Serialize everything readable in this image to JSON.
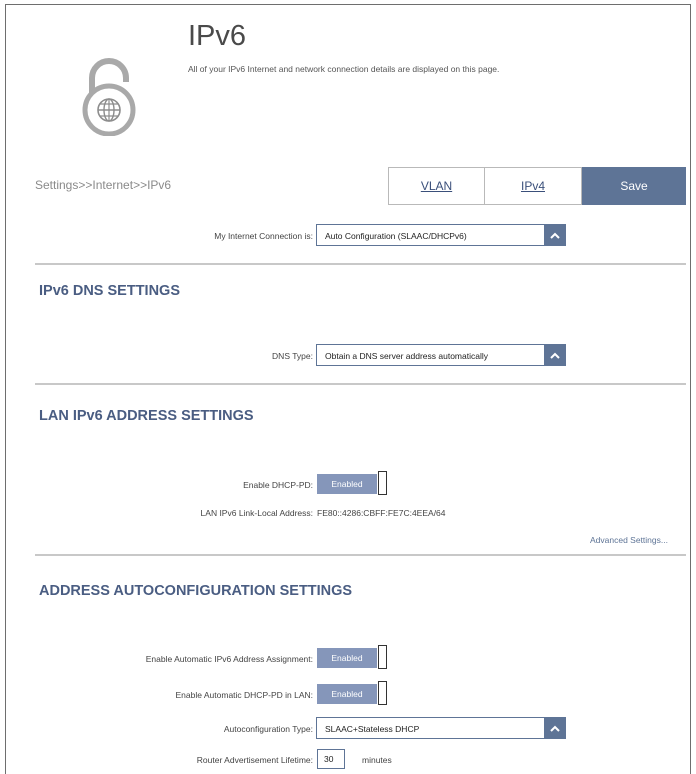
{
  "header": {
    "title": "IPv6",
    "description": "All of your IPv6 Internet and network connection details are displayed on this page."
  },
  "breadcrumb": "Settings>>Internet>>IPv6",
  "toolbar": {
    "vlan_label": "VLAN",
    "ipv4_label": "IPv4",
    "save_label": "Save"
  },
  "connection": {
    "label": "My Internet Connection is:",
    "value": "Auto Configuration (SLAAC/DHCPv6)"
  },
  "dns_section": {
    "title": "IPv6 DNS SETTINGS",
    "dns_type_label": "DNS Type:",
    "dns_type_value": "Obtain a DNS server address automatically"
  },
  "lan_section": {
    "title": "LAN IPv6 ADDRESS SETTINGS",
    "dhcp_pd_label": "Enable DHCP-PD:",
    "dhcp_pd_state": "Enabled",
    "link_local_label": "LAN IPv6 Link-Local Address:",
    "link_local_value": "FE80::4286:CBFF:FE7C:4EEA/64",
    "advanced_link": "Advanced Settings..."
  },
  "autoconf_section": {
    "title": "ADDRESS AUTOCONFIGURATION SETTINGS",
    "auto_assign_label": "Enable Automatic IPv6 Address Assignment:",
    "auto_assign_state": "Enabled",
    "auto_dhcp_pd_label": "Enable Automatic DHCP-PD in LAN:",
    "auto_dhcp_pd_state": "Enabled",
    "type_label": "Autoconfiguration Type:",
    "type_value": "SLAAC+Stateless DHCP",
    "lifetime_label": "Router Advertisement Lifetime:",
    "lifetime_value": "30",
    "lifetime_unit": "minutes"
  },
  "colors": {
    "accent": "#5e7496",
    "toggle_on": "#8596ba",
    "section_title": "#4a5d82"
  },
  "icons": {
    "page_icon": "lock-globe-icon",
    "dropdown": "chevron-up-icon"
  }
}
